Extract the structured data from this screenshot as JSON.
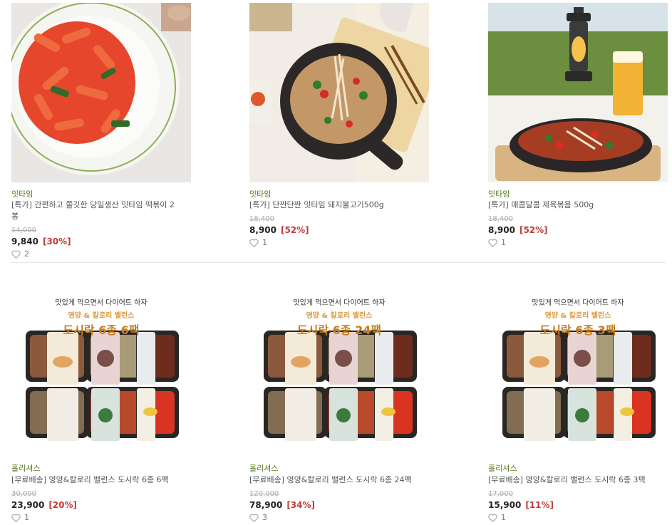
{
  "products": [
    {
      "brand": "잇타임",
      "title": "[특가] 간편하고 쫄깃한 당일생산 잇타임 떡볶이 2봉",
      "title_line1": "[특가] 간편하고 쫄깃한 당일생산 잇타임 떡볶이 2",
      "title_line2": "봉",
      "original_price": "14,000",
      "price": "9,840",
      "discount": "[30%]",
      "likes": "2",
      "image": "tteokbokki"
    },
    {
      "brand": "잇타임",
      "title": "[특가] 단짠단짠 잇타임 돼지불고기500g",
      "original_price": "18,400",
      "price": "8,900",
      "discount": "[52%]",
      "likes": "1",
      "image": "pork-bulgogi"
    },
    {
      "brand": "잇타임",
      "title": "[특가] 매콤달콤 제육볶음 500g",
      "original_price": "18,400",
      "price": "8,900",
      "discount": "[52%]",
      "likes": "1",
      "image": "jeyuk-bokkeum"
    },
    {
      "brand": "홀리셔스",
      "title": "[무료배송] 영양&칼로리 밸런스 도시락 6종 6팩",
      "original_price": "30,000",
      "price": "23,900",
      "discount": "[20%]",
      "likes": "1",
      "image": "dosirak",
      "banner_line1": "맛있게 먹으면서 다이어트 하자",
      "banner_line2": "영양 & 칼로리 밸런스",
      "banner_line3": "도시락 6종 6팩"
    },
    {
      "brand": "홀리셔스",
      "title": "[무료배송] 영양&칼로리 밸런스 도시락 6종 24팩",
      "original_price": "120,000",
      "price": "78,900",
      "discount": "[34%]",
      "likes": "3",
      "image": "dosirak",
      "banner_line1": "맛있게 먹으면서 다이어트 하자",
      "banner_line2": "영양 & 칼로리 밸런스",
      "banner_line3": "도시락 6종 24팩"
    },
    {
      "brand": "홀리셔스",
      "title": "[무료배송] 영양&칼로리 밸런스 도시락 6종 3팩",
      "original_price": "17,000",
      "price": "15,900",
      "discount": "[11%]",
      "likes": "1",
      "image": "dosirak",
      "banner_line1": "맛있게 먹으면서 다이어트 하자",
      "banner_line2": "영양 & 칼로리 밸런스",
      "banner_line3": "도시락 6종 3팩"
    }
  ],
  "colors": {
    "brand": "#5a7b1f",
    "discount": "#c23a3a",
    "divider": "#e6e6e6"
  }
}
